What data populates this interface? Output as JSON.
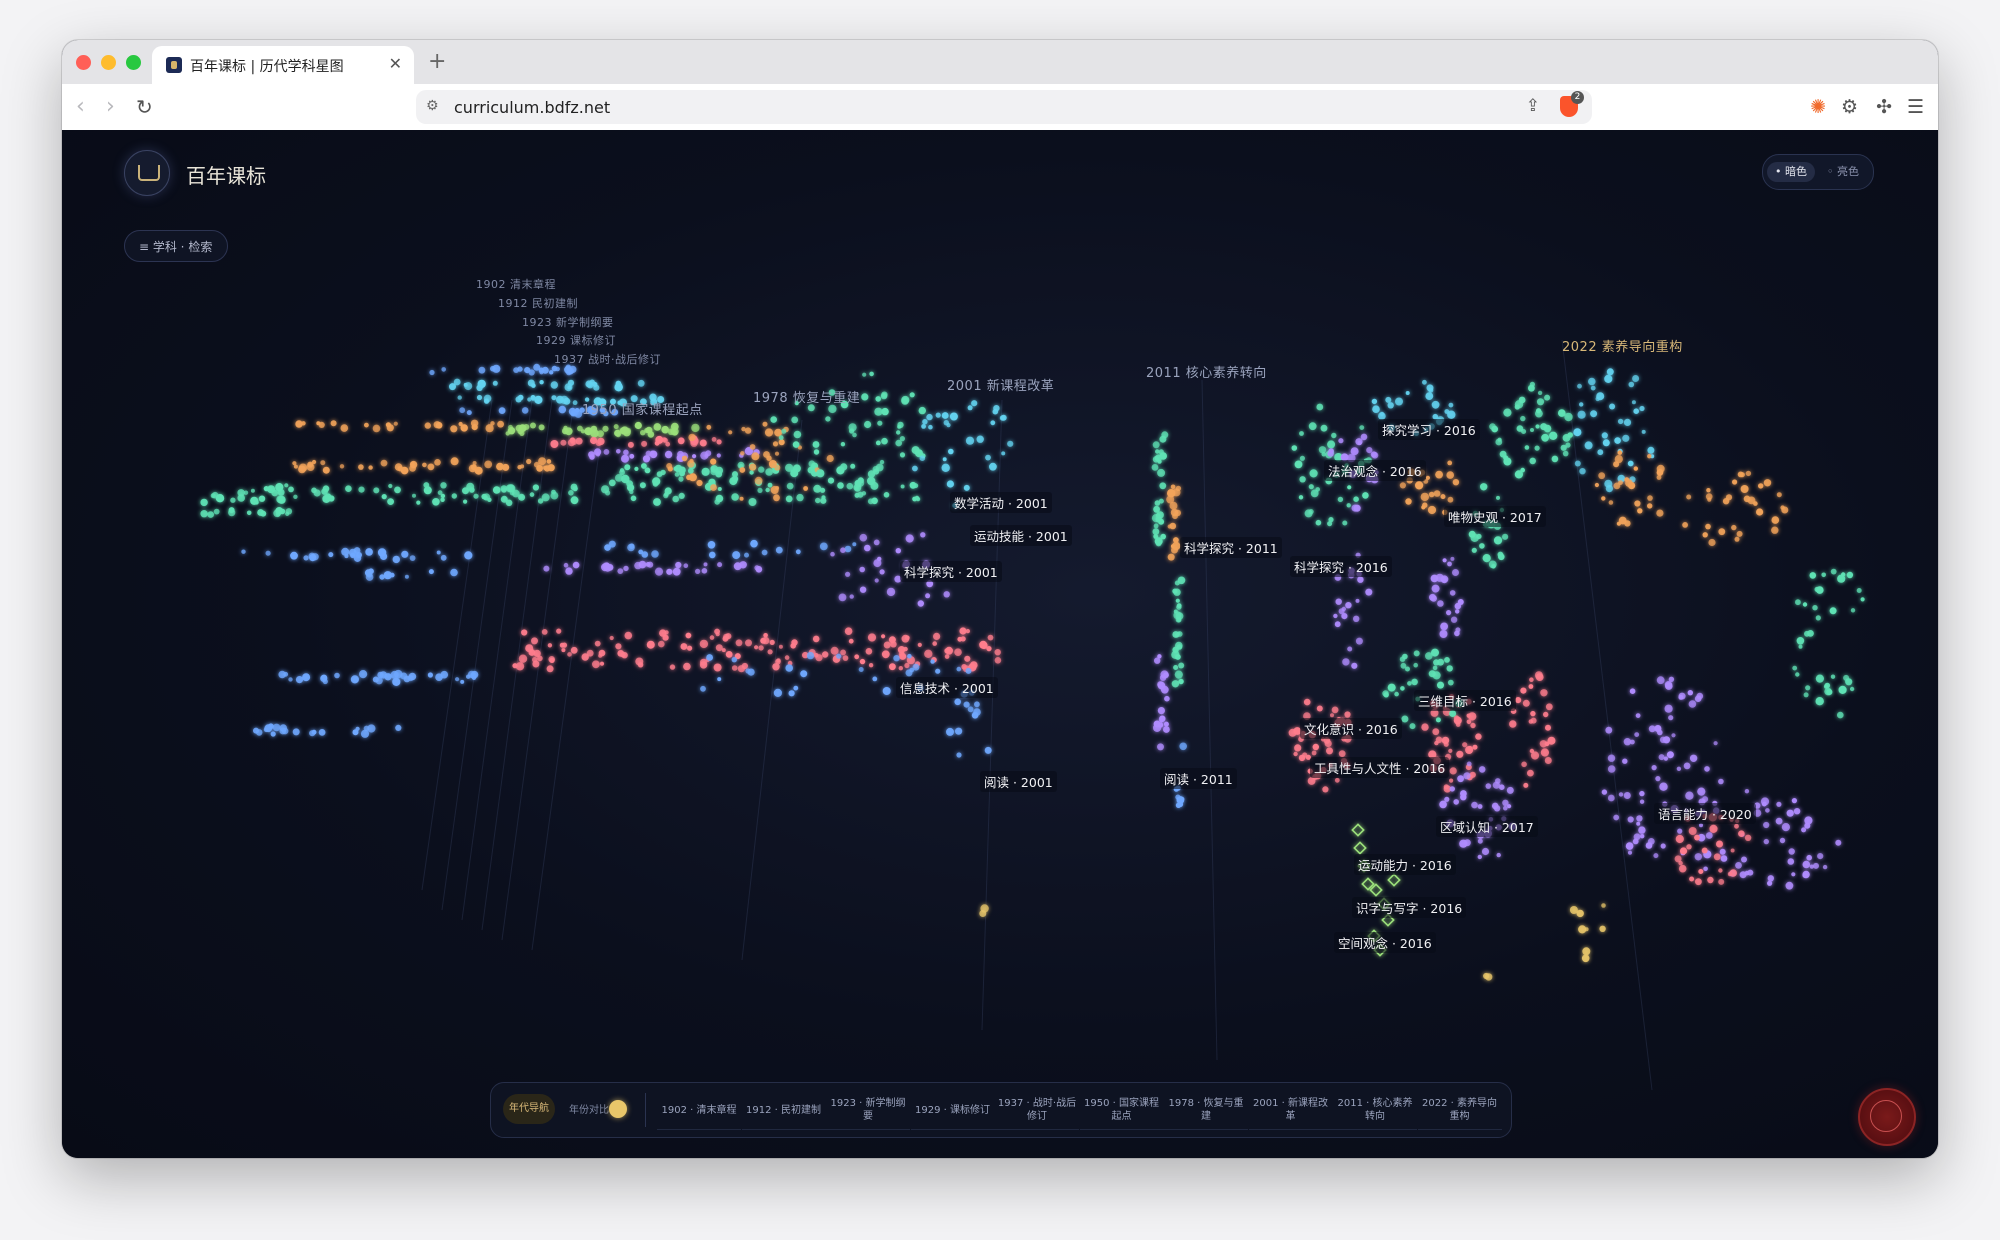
{
  "browser": {
    "tab_title": "百年课标 | 历代学科星图",
    "url": "curriculum.bdfz.net",
    "badge_count": "2"
  },
  "app": {
    "title": "百年课标",
    "theme_dark": "• 暗色",
    "theme_light": "◦ 亮色",
    "search_label": "≡  学科 · 检索"
  },
  "era_labels": [
    {
      "id": "e1902",
      "text": "1902  清末章程",
      "cls": "small"
    },
    {
      "id": "e1912",
      "text": "1912  民初建制",
      "cls": "small"
    },
    {
      "id": "e1923",
      "text": "1923  新学制纲要",
      "cls": "small"
    },
    {
      "id": "e1929",
      "text": "1929  课标修订",
      "cls": "small"
    },
    {
      "id": "e1937",
      "text": "1937  战时·战后修订",
      "cls": "small"
    },
    {
      "id": "e1950",
      "text": "1950  国家课程起点",
      "cls": ""
    },
    {
      "id": "e1978",
      "text": "1978  恢复与重建",
      "cls": ""
    },
    {
      "id": "e2001",
      "text": "2001  新课程改革",
      "cls": ""
    },
    {
      "id": "e2011",
      "text": "2011  核心素养转向",
      "cls": ""
    },
    {
      "id": "e2022",
      "text": "2022  素养导向重构",
      "cls": "gold"
    }
  ],
  "point_labels": [
    "数学活动 · 2001",
    "运动技能 · 2001",
    "科学探究 · 2001",
    "信息技术 · 2001",
    "阅读 · 2001",
    "科学探究 · 2011",
    "阅读 · 2011",
    "探究学习 · 2016",
    "法治观念 · 2016",
    "唯物史观 · 2017",
    "科学探究 · 2016",
    "三维目标 · 2016",
    "文化意识 · 2016",
    "工具性与人文性 · 2016",
    "区域认知 · 2017",
    "运动能力 · 2016",
    "识字与写字 · 2016",
    "空间观念 · 2016",
    "语言能力 · 2020"
  ],
  "bottom_bar": {
    "mode_nav": "年代导航",
    "mode_compare": "年份对比",
    "eras": [
      [
        "1902 · 清末章程"
      ],
      [
        "1912 · 民初建制"
      ],
      [
        "1923 · 新学制纲",
        "要"
      ],
      [
        "1929 · 课标修订"
      ],
      [
        "1937 · 战时·战后",
        "修订"
      ],
      [
        "1950 · 国家课程",
        "起点"
      ],
      [
        "1978 · 恢复与重",
        "建"
      ],
      [
        "2001 · 新课程改",
        "革"
      ],
      [
        "2011 · 核心素养",
        "转向"
      ],
      [
        "2022 · 素养导向",
        "重构"
      ]
    ]
  },
  "colors": {
    "teal": "#5fe3b5",
    "blue": "#6fa8ff",
    "cyan": "#63d3f0",
    "orange": "#f3a45a",
    "pink": "#ff7d8d",
    "purple": "#b08cff",
    "green": "#9be07a",
    "gold": "#e8c66a"
  }
}
